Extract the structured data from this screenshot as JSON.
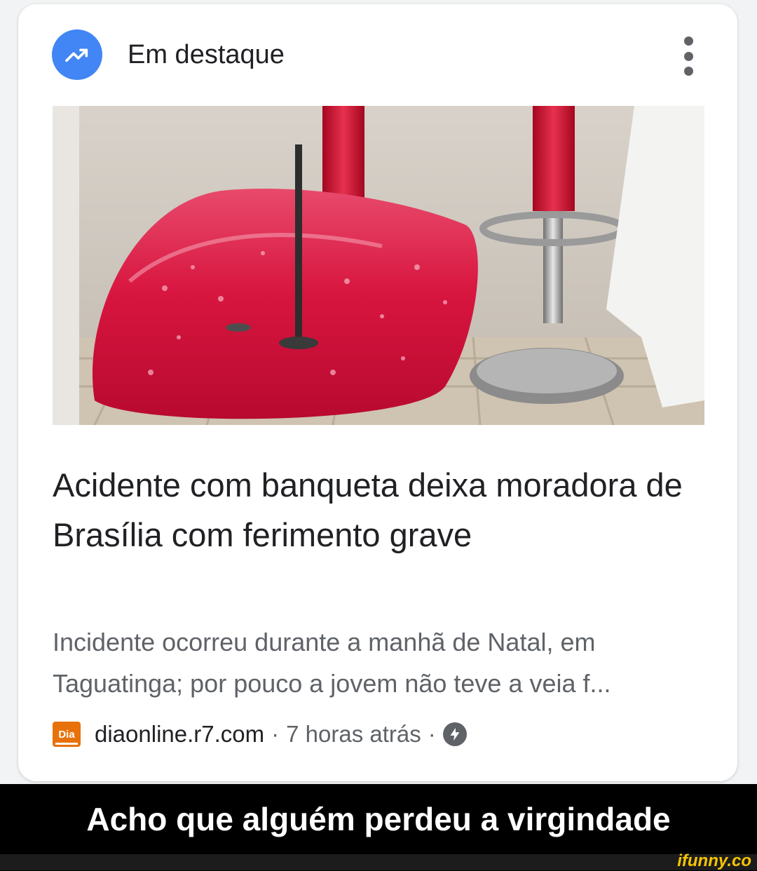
{
  "card": {
    "header_title": "Em destaque",
    "header_icon": "trending-up-icon",
    "menu_icon": "more-vert-icon",
    "headline": "Acidente com banqueta deixa moradora de Brasília com ferimento grave",
    "snippet": "Incidente ocorreu durante a manhã de Natal, em Taguatinga; por pouco a jovem não teve a veia f...",
    "source": {
      "favicon_text": "Dia",
      "domain": "diaonline.r7.com",
      "separator": "·",
      "time": "7 horas atrás",
      "amp_icon": "bolt-icon"
    },
    "accent_color": "#4285f4",
    "favicon_color": "#e8710a"
  },
  "caption": "Acho que alguém perdeu a virgindade",
  "watermark": "ifunny.co"
}
